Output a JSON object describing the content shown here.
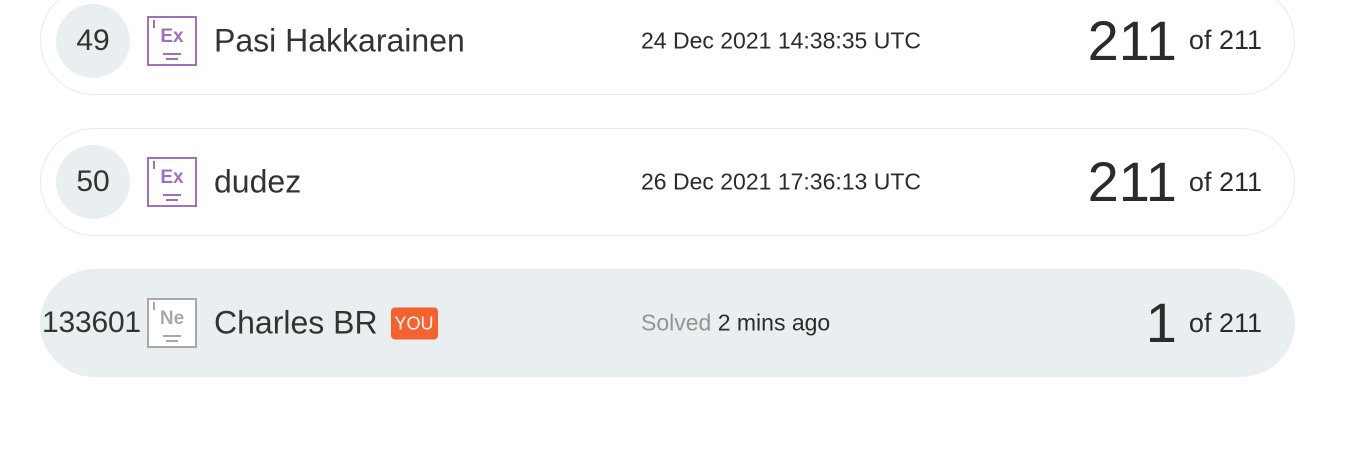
{
  "leaderboard": {
    "rows": [
      {
        "rank": "49",
        "badge_symbol": "Ex",
        "name": "Pasi Hakkarainen",
        "date": "24 Dec 2021 14:38:35 UTC",
        "score": "211",
        "total": "of 211"
      },
      {
        "rank": "50",
        "badge_symbol": "Ex",
        "name": "dudez",
        "date": "26 Dec 2021 17:36:13 UTC",
        "score": "211",
        "total": "of 211"
      }
    ],
    "current_user": {
      "rank": "133601",
      "badge_symbol": "Ne",
      "name": "Charles BR",
      "you_label": "YOU",
      "solved_label": "Solved",
      "solved_time": "2 mins ago",
      "score": "1",
      "total": "of 211"
    }
  },
  "colors": {
    "expert_badge": "#a070c0",
    "newbie_badge": "#a8a8a8",
    "you_tag": "#f4632f",
    "highlight_row": "#e9eef1"
  }
}
